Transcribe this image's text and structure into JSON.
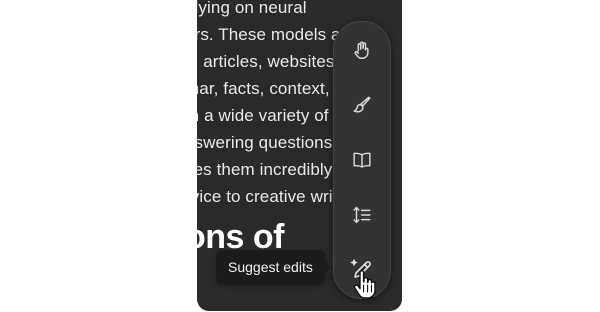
{
  "article": {
    "lines": [
      "elying on neural",
      "ers. These models are",
      "s, articles, websites, ",
      "mar, facts, context, ",
      "m a wide variety of t",
      "nswering questions, ",
      "kes them incredibly ",
      "rvice to creative writ"
    ],
    "heading": "ons of"
  },
  "toolbar": {
    "tools": [
      {
        "icon": "hand-icon"
      },
      {
        "icon": "paintbrush-icon"
      },
      {
        "icon": "book-icon"
      },
      {
        "icon": "line-spacing-icon"
      },
      {
        "icon": "sparkle-pencil-icon"
      }
    ],
    "tooltip": "Suggest edits"
  },
  "colors": {
    "panel_bg": "#2a2a2a",
    "toolbar_bg": "#333333",
    "tooltip_bg": "#1b1b1b",
    "text": "#e9e9e9"
  }
}
